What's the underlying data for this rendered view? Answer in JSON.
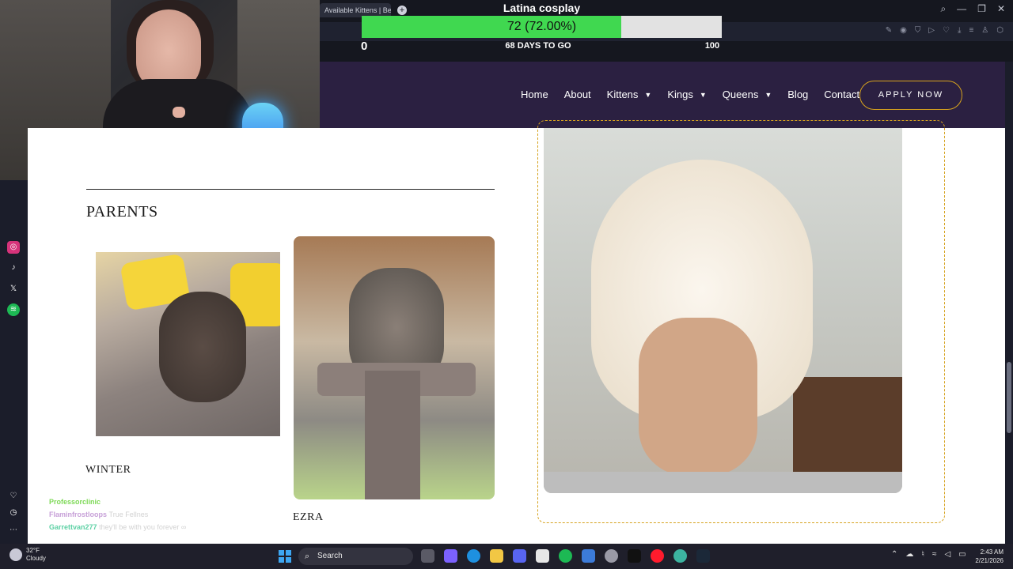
{
  "browser": {
    "tab_label": "Available Kittens | Bellatrix",
    "new_tab_icon": "plus-icon"
  },
  "goal": {
    "title": "Latina cosplay",
    "progress_text": "72 (72.00%)",
    "progress_value": 72,
    "progress_percent": 72.0,
    "min": "0",
    "days_to_go": "68 DAYS TO GO",
    "max": "100",
    "fill_color": "#40d850"
  },
  "nav": {
    "items": [
      {
        "label": "Home",
        "has_dropdown": false
      },
      {
        "label": "About",
        "has_dropdown": false
      },
      {
        "label": "Kittens",
        "has_dropdown": true
      },
      {
        "label": "Kings",
        "has_dropdown": true
      },
      {
        "label": "Queens",
        "has_dropdown": true
      },
      {
        "label": "Blog",
        "has_dropdown": false
      },
      {
        "label": "Contact",
        "has_dropdown": false
      }
    ],
    "apply_label": "APPLY NOW",
    "background": "#2b2041",
    "accent": "#d6a21e"
  },
  "content": {
    "section_title": "PARENTS",
    "parents": [
      {
        "name": "WINTER"
      },
      {
        "name": "EZRA"
      }
    ]
  },
  "chat": [
    {
      "user": "Professorclinic",
      "text": "",
      "color": "#7ed957"
    },
    {
      "user": "Flaminfrostloops",
      "text": "True Fellnes",
      "color": "#c7a0d8"
    },
    {
      "user": "Garrettvan277",
      "text": "they'll be with you forever ∞",
      "color": "#5ed1a5"
    }
  ],
  "taskbar": {
    "weather_temp": "32°F",
    "weather_desc": "Cloudy",
    "search_label": "Search",
    "time": "2:43 AM",
    "date": "2/21/2026"
  }
}
